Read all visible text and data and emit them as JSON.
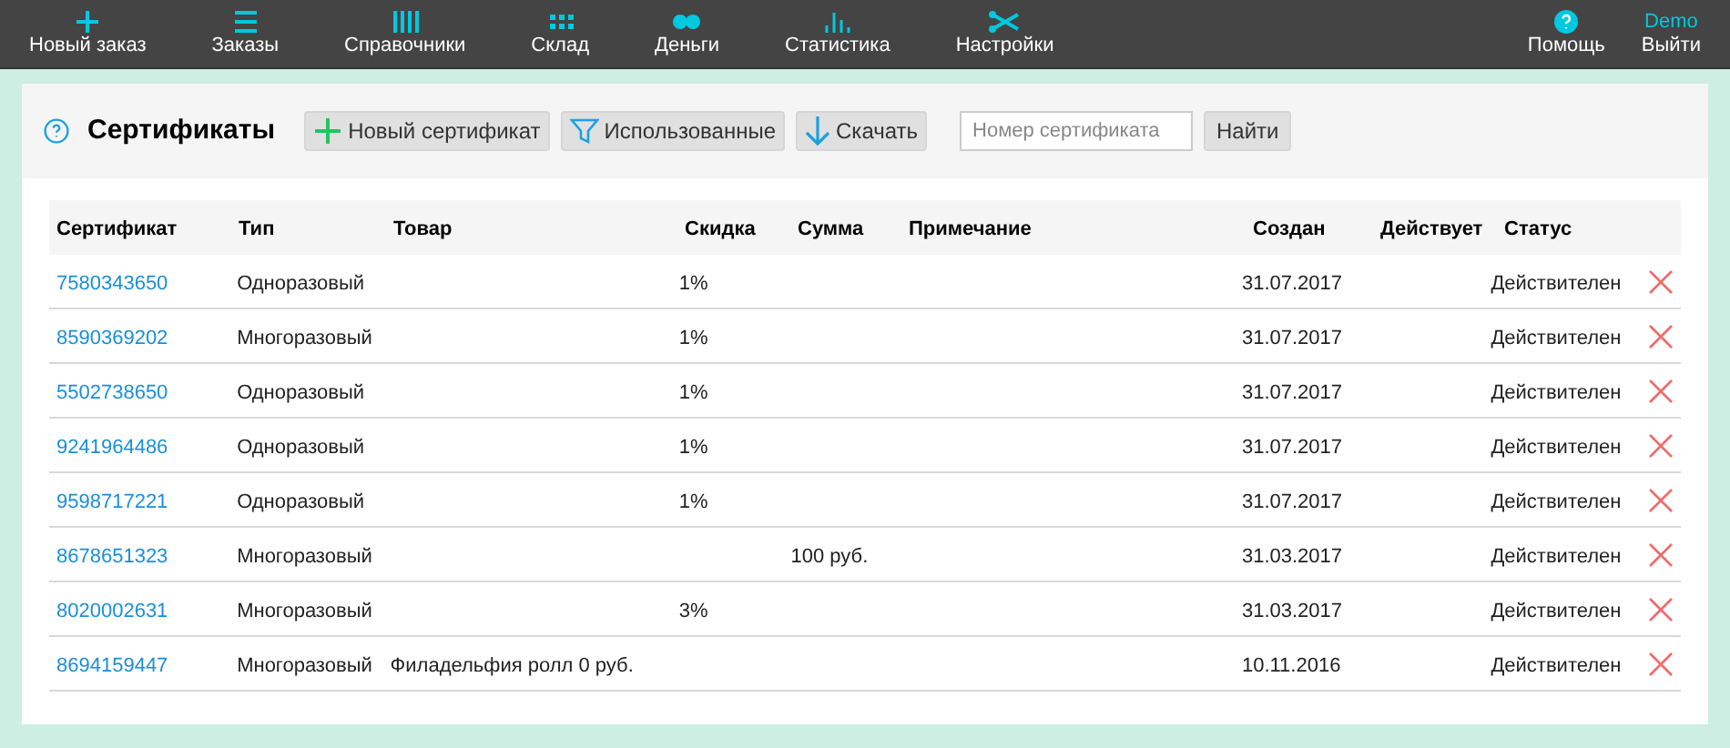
{
  "nav": [
    {
      "label": "Новый заказ"
    },
    {
      "label": "Заказы"
    },
    {
      "label": "Справочники"
    },
    {
      "label": "Склад"
    },
    {
      "label": "Деньги"
    },
    {
      "label": "Статистика"
    },
    {
      "label": "Настройки"
    }
  ],
  "help": {
    "label": "Помощь"
  },
  "user": {
    "name": "Demo",
    "logout": "Выйти"
  },
  "page": {
    "title": "Сертификаты",
    "buttons": [
      {
        "label": "Новый сертификат"
      },
      {
        "label": "Использованные"
      },
      {
        "label": "Скачать"
      }
    ],
    "search": {
      "placeholder": "Номер сертификата",
      "button": "Найти"
    }
  },
  "table": {
    "columns": [
      "Сертификат",
      "Тип",
      "Товар",
      "Скидка",
      "Сумма",
      "Примечание",
      "Создан",
      "Действует",
      "Статус"
    ],
    "rows": [
      [
        "7580343650",
        "Одноразовый",
        "",
        "1%",
        "",
        "",
        "31.07.2017",
        "",
        "Действителен"
      ],
      [
        "8590369202",
        "Многоразовый",
        "",
        "1%",
        "",
        "",
        "31.07.2017",
        "",
        "Действителен"
      ],
      [
        "5502738650",
        "Одноразовый",
        "",
        "1%",
        "",
        "",
        "31.07.2017",
        "",
        "Действителен"
      ],
      [
        "9241964486",
        "Одноразовый",
        "",
        "1%",
        "",
        "",
        "31.07.2017",
        "",
        "Действителен"
      ],
      [
        "9598717221",
        "Одноразовый",
        "",
        "1%",
        "",
        "",
        "31.07.2017",
        "",
        "Действителен"
      ],
      [
        "8678651323",
        "Многоразовый",
        "",
        "",
        "100 руб.",
        "",
        "31.03.2017",
        "",
        "Действителен"
      ],
      [
        "8020002631",
        "Многоразовый",
        "",
        "3%",
        "",
        "",
        "31.03.2017",
        "",
        "Действителен"
      ],
      [
        "8694159447",
        "Многоразовый",
        "Филадельфия ролл 0 руб.",
        "",
        "",
        "",
        "10.11.2016",
        "",
        "Действителен"
      ]
    ]
  }
}
